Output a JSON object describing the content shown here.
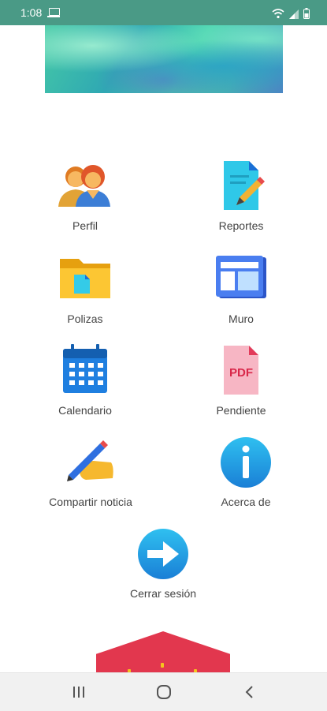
{
  "status": {
    "time": "1:08",
    "icons": [
      "laptop-icon",
      "wifi-icon",
      "signal-icon",
      "battery-icon"
    ]
  },
  "colors": {
    "status_bar": "#4a9a86",
    "label_text": "#444444",
    "nav_bar": "#f1f1f1"
  },
  "menu": {
    "items": [
      {
        "label": "Perfil",
        "icon": "users-icon"
      },
      {
        "label": "Reportes",
        "icon": "report-icon"
      },
      {
        "label": "Polizas",
        "icon": "folder-icon"
      },
      {
        "label": "Muro",
        "icon": "wall-icon"
      },
      {
        "label": "Calendario",
        "icon": "calendar-icon"
      },
      {
        "label": "Pendiente",
        "icon": "pdf-icon"
      },
      {
        "label": "Compartir noticia",
        "icon": "share-news-icon"
      },
      {
        "label": "Acerca de",
        "icon": "info-icon"
      },
      {
        "label": "Cerrar sesión",
        "icon": "logout-icon"
      }
    ],
    "pdf_text": "PDF"
  },
  "nav": {
    "buttons": [
      "recent-apps-icon",
      "home-icon",
      "back-icon"
    ]
  }
}
